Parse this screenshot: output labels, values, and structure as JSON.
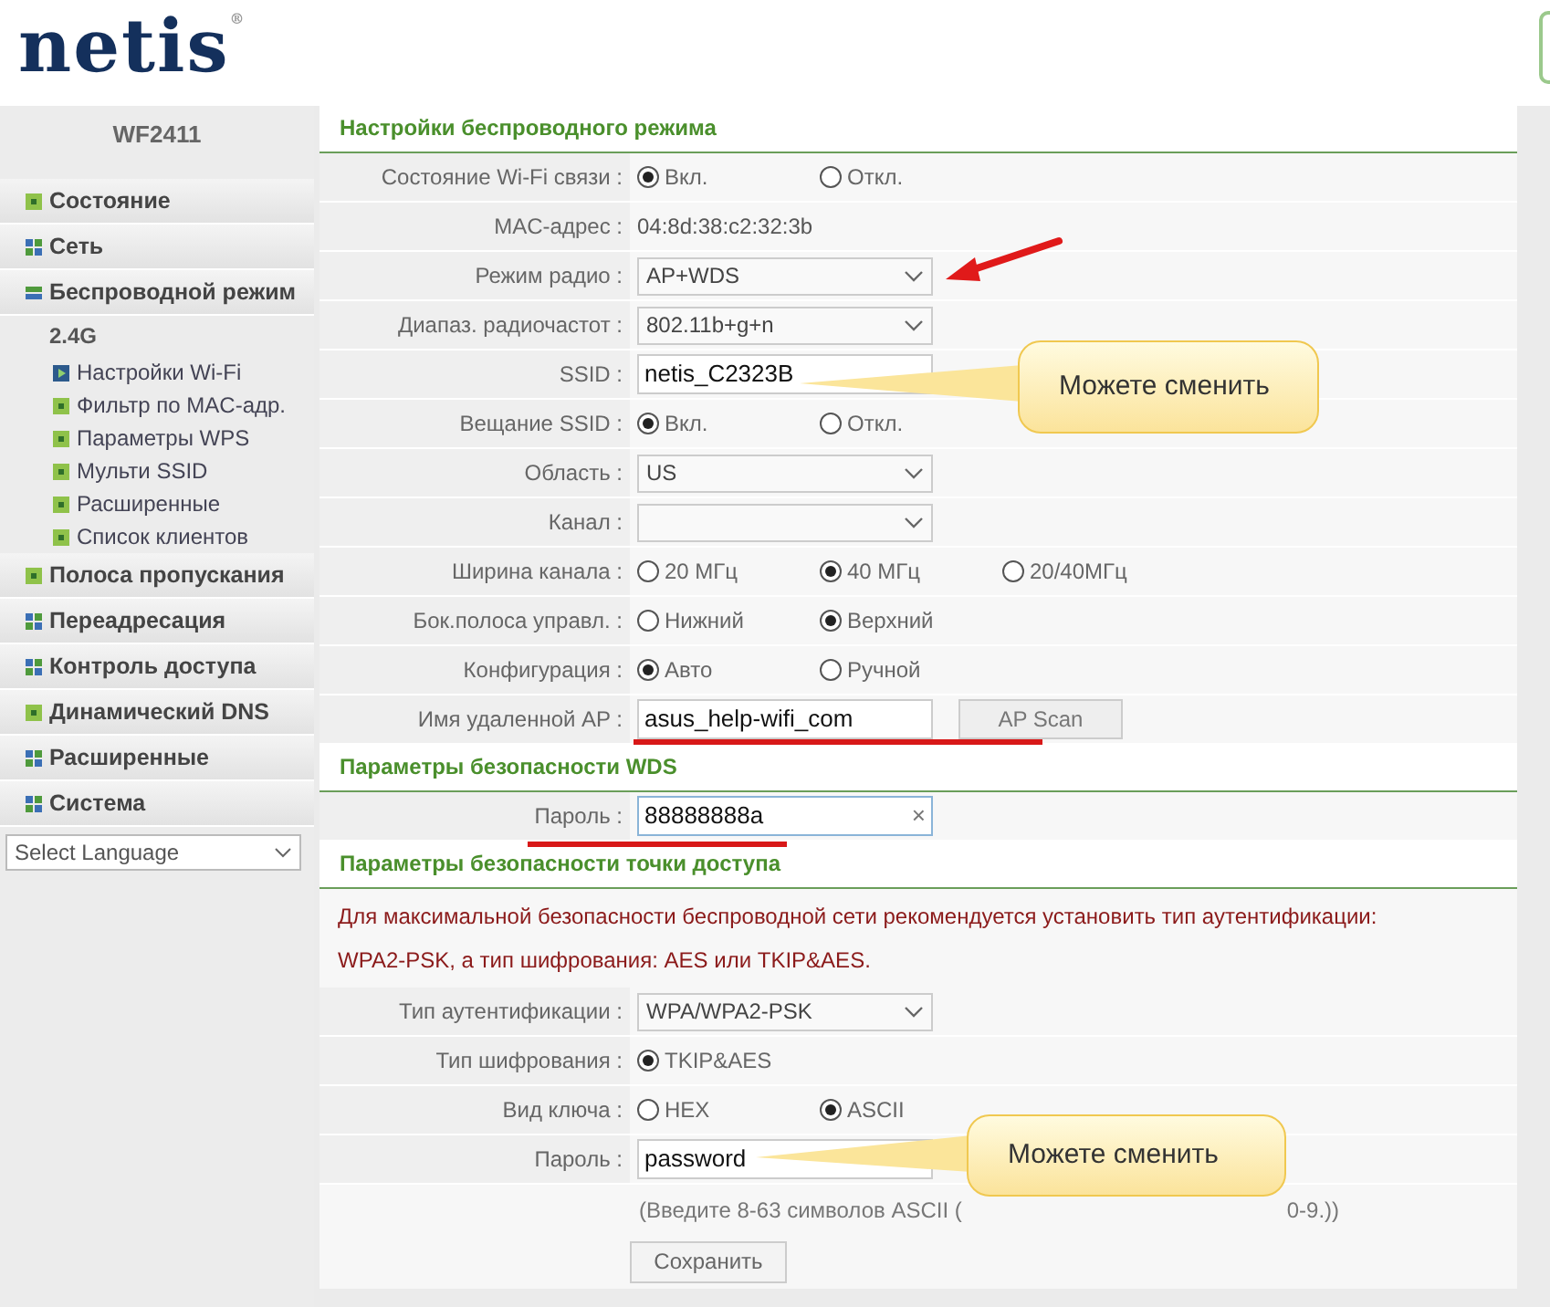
{
  "logo": {
    "text": "netis",
    "mark": "®"
  },
  "model": "WF2411",
  "menu": [
    {
      "label": "Состояние",
      "kind": "page",
      "expanded": false
    },
    {
      "label": "Сеть",
      "kind": "group",
      "expanded": false
    },
    {
      "label": "Беспроводной режим",
      "kind": "group",
      "expanded": true,
      "children": [
        {
          "label": "2.4G",
          "children": [
            {
              "label": "Настройки Wi-Fi",
              "selected": true
            },
            {
              "label": "Фильтр по MAC-адр.",
              "selected": false
            },
            {
              "label": "Параметры WPS",
              "selected": false
            },
            {
              "label": "Мульти SSID",
              "selected": false
            },
            {
              "label": "Расширенные",
              "selected": false
            },
            {
              "label": "Список клиентов",
              "selected": false
            }
          ]
        }
      ]
    },
    {
      "label": "Полоса пропускания",
      "kind": "page",
      "expanded": false
    },
    {
      "label": "Переадресация",
      "kind": "group",
      "expanded": false
    },
    {
      "label": "Контроль доступа",
      "kind": "group",
      "expanded": false
    },
    {
      "label": "Динамический DNS",
      "kind": "page",
      "expanded": false
    },
    {
      "label": "Расширенные",
      "kind": "group",
      "expanded": false
    },
    {
      "label": "Система",
      "kind": "group",
      "expanded": false
    }
  ],
  "language": "Select Language",
  "sections": [
    {
      "title": "Настройки беспроводного режима",
      "rows": [
        {
          "label": "Состояние Wi-Fi связи :",
          "kind": "radio",
          "options": [
            {
              "label": "Вкл.",
              "selected": true
            },
            {
              "label": "Откл.",
              "selected": false
            }
          ]
        },
        {
          "label": "MAC-адрес :",
          "kind": "text",
          "value": "04:8d:38:c2:32:3b"
        },
        {
          "label": "Режим радио :",
          "kind": "select",
          "value": "AP+WDS"
        },
        {
          "label": "Диапаз. радиочастот :",
          "kind": "select",
          "value": "802.11b+g+n"
        },
        {
          "label": "SSID :",
          "kind": "input",
          "value": "netis_C2323B"
        },
        {
          "label": "Вещание SSID :",
          "kind": "radio",
          "options": [
            {
              "label": "Вкл.",
              "selected": true
            },
            {
              "label": "Откл.",
              "selected": false
            }
          ]
        },
        {
          "label": "Область :",
          "kind": "select",
          "value": "US"
        },
        {
          "label": "Канал :",
          "kind": "select"
        },
        {
          "label": "Ширина канала :",
          "kind": "radio",
          "options": [
            {
              "label": "20 МГц",
              "selected": false
            },
            {
              "label": "40 МГц",
              "selected": true
            },
            {
              "label": "20/40МГц",
              "selected": false
            }
          ]
        },
        {
          "label": "Бок.полоса управл. :",
          "kind": "radio",
          "options": [
            {
              "label": "Нижний",
              "selected": false
            },
            {
              "label": "Верхний",
              "selected": true
            }
          ]
        },
        {
          "label": "Конфигурация :",
          "kind": "radio",
          "options": [
            {
              "label": "Авто",
              "selected": true
            },
            {
              "label": "Ручной",
              "selected": false
            }
          ]
        },
        {
          "label": "Имя удаленной AP :",
          "kind": "input_button",
          "value": "asus_help-wifi_com",
          "button": "AP Scan"
        }
      ]
    },
    {
      "title": "Параметры безопасности WDS",
      "rows": [
        {
          "label": "Пароль :",
          "kind": "input_clear",
          "value": "88888888a",
          "clear": "×"
        }
      ]
    },
    {
      "title": "Параметры безопасности точки доступа",
      "notice": [
        "Для максимальной безопасности беспроводной сети рекомендуется установить тип аутентификации:",
        "WPA2-PSK, а тип шифрования: AES или TKIP&AES."
      ],
      "rows": [
        {
          "label": "Тип аутентификации :",
          "kind": "select",
          "value": "WPA/WPA2-PSK"
        },
        {
          "label": "Тип шифрования :",
          "kind": "radio",
          "options": [
            {
              "label": "TKIP&AES",
              "selected": true
            }
          ]
        },
        {
          "label": "Вид ключа :",
          "kind": "radio",
          "options": [
            {
              "label": "HEX",
              "selected": false
            },
            {
              "label": "ASCII",
              "selected": true
            }
          ]
        },
        {
          "label": "Пароль :",
          "kind": "input",
          "value": "password"
        },
        {
          "kind": "hint",
          "hint_start": "(Введите 8-63 символов ASCII (",
          "hint_end": "0-9.))"
        },
        {
          "kind": "save",
          "button": "Сохранить"
        }
      ]
    }
  ],
  "callouts": [
    {
      "text": "Можете сменить"
    },
    {
      "text": "Можете сменить"
    }
  ]
}
